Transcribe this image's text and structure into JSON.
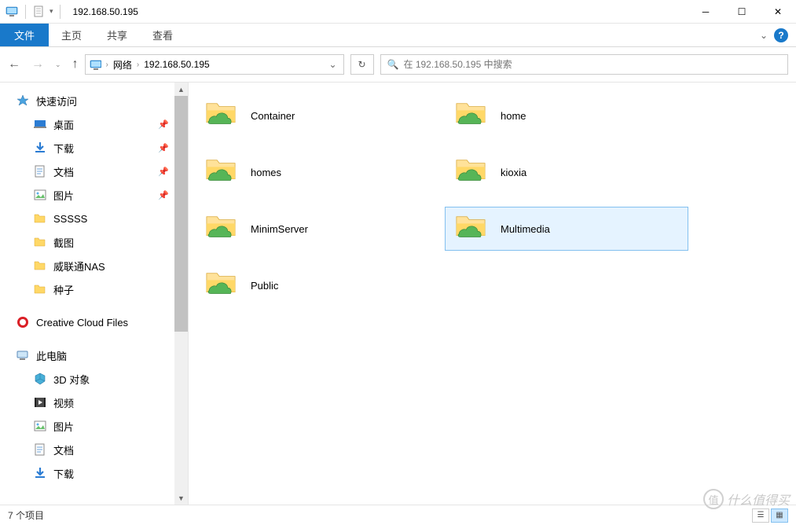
{
  "window": {
    "title": "192.168.50.195",
    "minimize": "─",
    "maximize": "☐",
    "close": "✕"
  },
  "ribbon": {
    "file": "文件",
    "tabs": [
      "主页",
      "共享",
      "查看"
    ],
    "expand": "⌄"
  },
  "nav": {
    "back": "←",
    "forward": "→",
    "recent": "⌄",
    "up": "↑",
    "refresh": "↻"
  },
  "address": {
    "root": "网络",
    "path": "192.168.50.195"
  },
  "search": {
    "placeholder": "在 192.168.50.195 中搜索"
  },
  "sidebar": {
    "quick_access": "快速访问",
    "items": [
      {
        "label": "桌面",
        "pinned": true,
        "icon": "desktop"
      },
      {
        "label": "下载",
        "pinned": true,
        "icon": "download"
      },
      {
        "label": "文档",
        "pinned": true,
        "icon": "document"
      },
      {
        "label": "图片",
        "pinned": true,
        "icon": "picture"
      },
      {
        "label": "SSSSS",
        "pinned": false,
        "icon": "folder"
      },
      {
        "label": "截图",
        "pinned": false,
        "icon": "folder"
      },
      {
        "label": "威联通NAS",
        "pinned": false,
        "icon": "folder"
      },
      {
        "label": "种子",
        "pinned": false,
        "icon": "folder"
      }
    ],
    "creative_cloud": "Creative Cloud Files",
    "this_pc": "此电脑",
    "pc_items": [
      {
        "label": "3D 对象",
        "icon": "3d"
      },
      {
        "label": "视频",
        "icon": "video"
      },
      {
        "label": "图片",
        "icon": "picture"
      },
      {
        "label": "文档",
        "icon": "document"
      },
      {
        "label": "下载",
        "icon": "download"
      }
    ]
  },
  "shares": [
    {
      "name": "Container",
      "selected": false
    },
    {
      "name": "home",
      "selected": false
    },
    {
      "name": "homes",
      "selected": false
    },
    {
      "name": "kioxia",
      "selected": false
    },
    {
      "name": "MinimServer",
      "selected": false
    },
    {
      "name": "Multimedia",
      "selected": true
    },
    {
      "name": "Public",
      "selected": false
    }
  ],
  "status": {
    "count": "7 个项目"
  },
  "watermark": "什么值得买"
}
